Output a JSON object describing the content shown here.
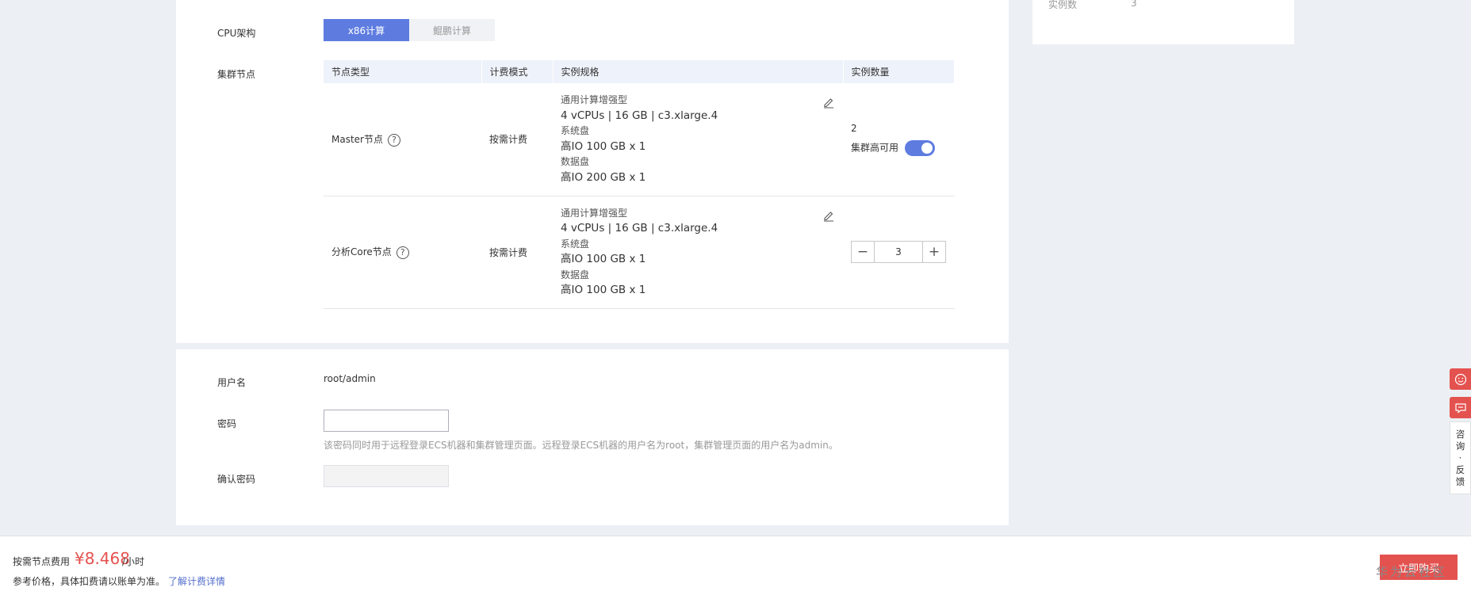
{
  "summary": {
    "instance_count_label": "实例数",
    "instance_count_value": "3"
  },
  "config": {
    "cpu_arch_label": "CPU架构",
    "cpu_options": [
      "x86计算",
      "鲲鹏计算"
    ],
    "cluster_nodes_label": "集群节点",
    "table_headers": [
      "节点类型",
      "计费模式",
      "实例规格",
      "实例数量"
    ],
    "rows": [
      {
        "node_type": "Master节点",
        "billing": "按需计费",
        "spec_type": "通用计算增强型",
        "spec": "4 vCPUs | 16 GB | c3.xlarge.4",
        "sys_disk_label": "系统盘",
        "sys_disk": "高IO 100 GB x 1",
        "data_disk_label": "数据盘",
        "data_disk": "高IO 200 GB x 1",
        "count": "2",
        "ha_label": "集群高可用"
      },
      {
        "node_type": "分析Core节点",
        "billing": "按需计费",
        "spec_type": "通用计算增强型",
        "spec": "4 vCPUs | 16 GB | c3.xlarge.4",
        "sys_disk_label": "系统盘",
        "sys_disk": "高IO 100 GB x 1",
        "data_disk_label": "数据盘",
        "data_disk": "高IO 100 GB x 1",
        "count": "3"
      }
    ],
    "help_glyph": "?",
    "minus_glyph": "−",
    "plus_glyph": "+"
  },
  "account": {
    "username_label": "用户名",
    "username_value": "root/admin",
    "password_label": "密码",
    "password_hint": "该密码同时用于远程登录ECS机器和集群管理页面。远程登录ECS机器的用户名为root，集群管理页面的用户名为admin。",
    "confirm_label": "确认密码"
  },
  "footer": {
    "price_label": "按需节点费用",
    "price_value": "¥8.468",
    "price_unit": "/小时",
    "ref_text": "参考价格，具体扣费请以账单为准。",
    "ref_link": "了解计费详情",
    "buy_button": "立即购买",
    "watermark": "华为云社区"
  },
  "float": {
    "consult_text": [
      "咨",
      "询",
      "·",
      "反",
      "馈"
    ]
  },
  "colors": {
    "primary": "#5e7ce0",
    "price": "#e4524f",
    "link": "#526ecc"
  }
}
